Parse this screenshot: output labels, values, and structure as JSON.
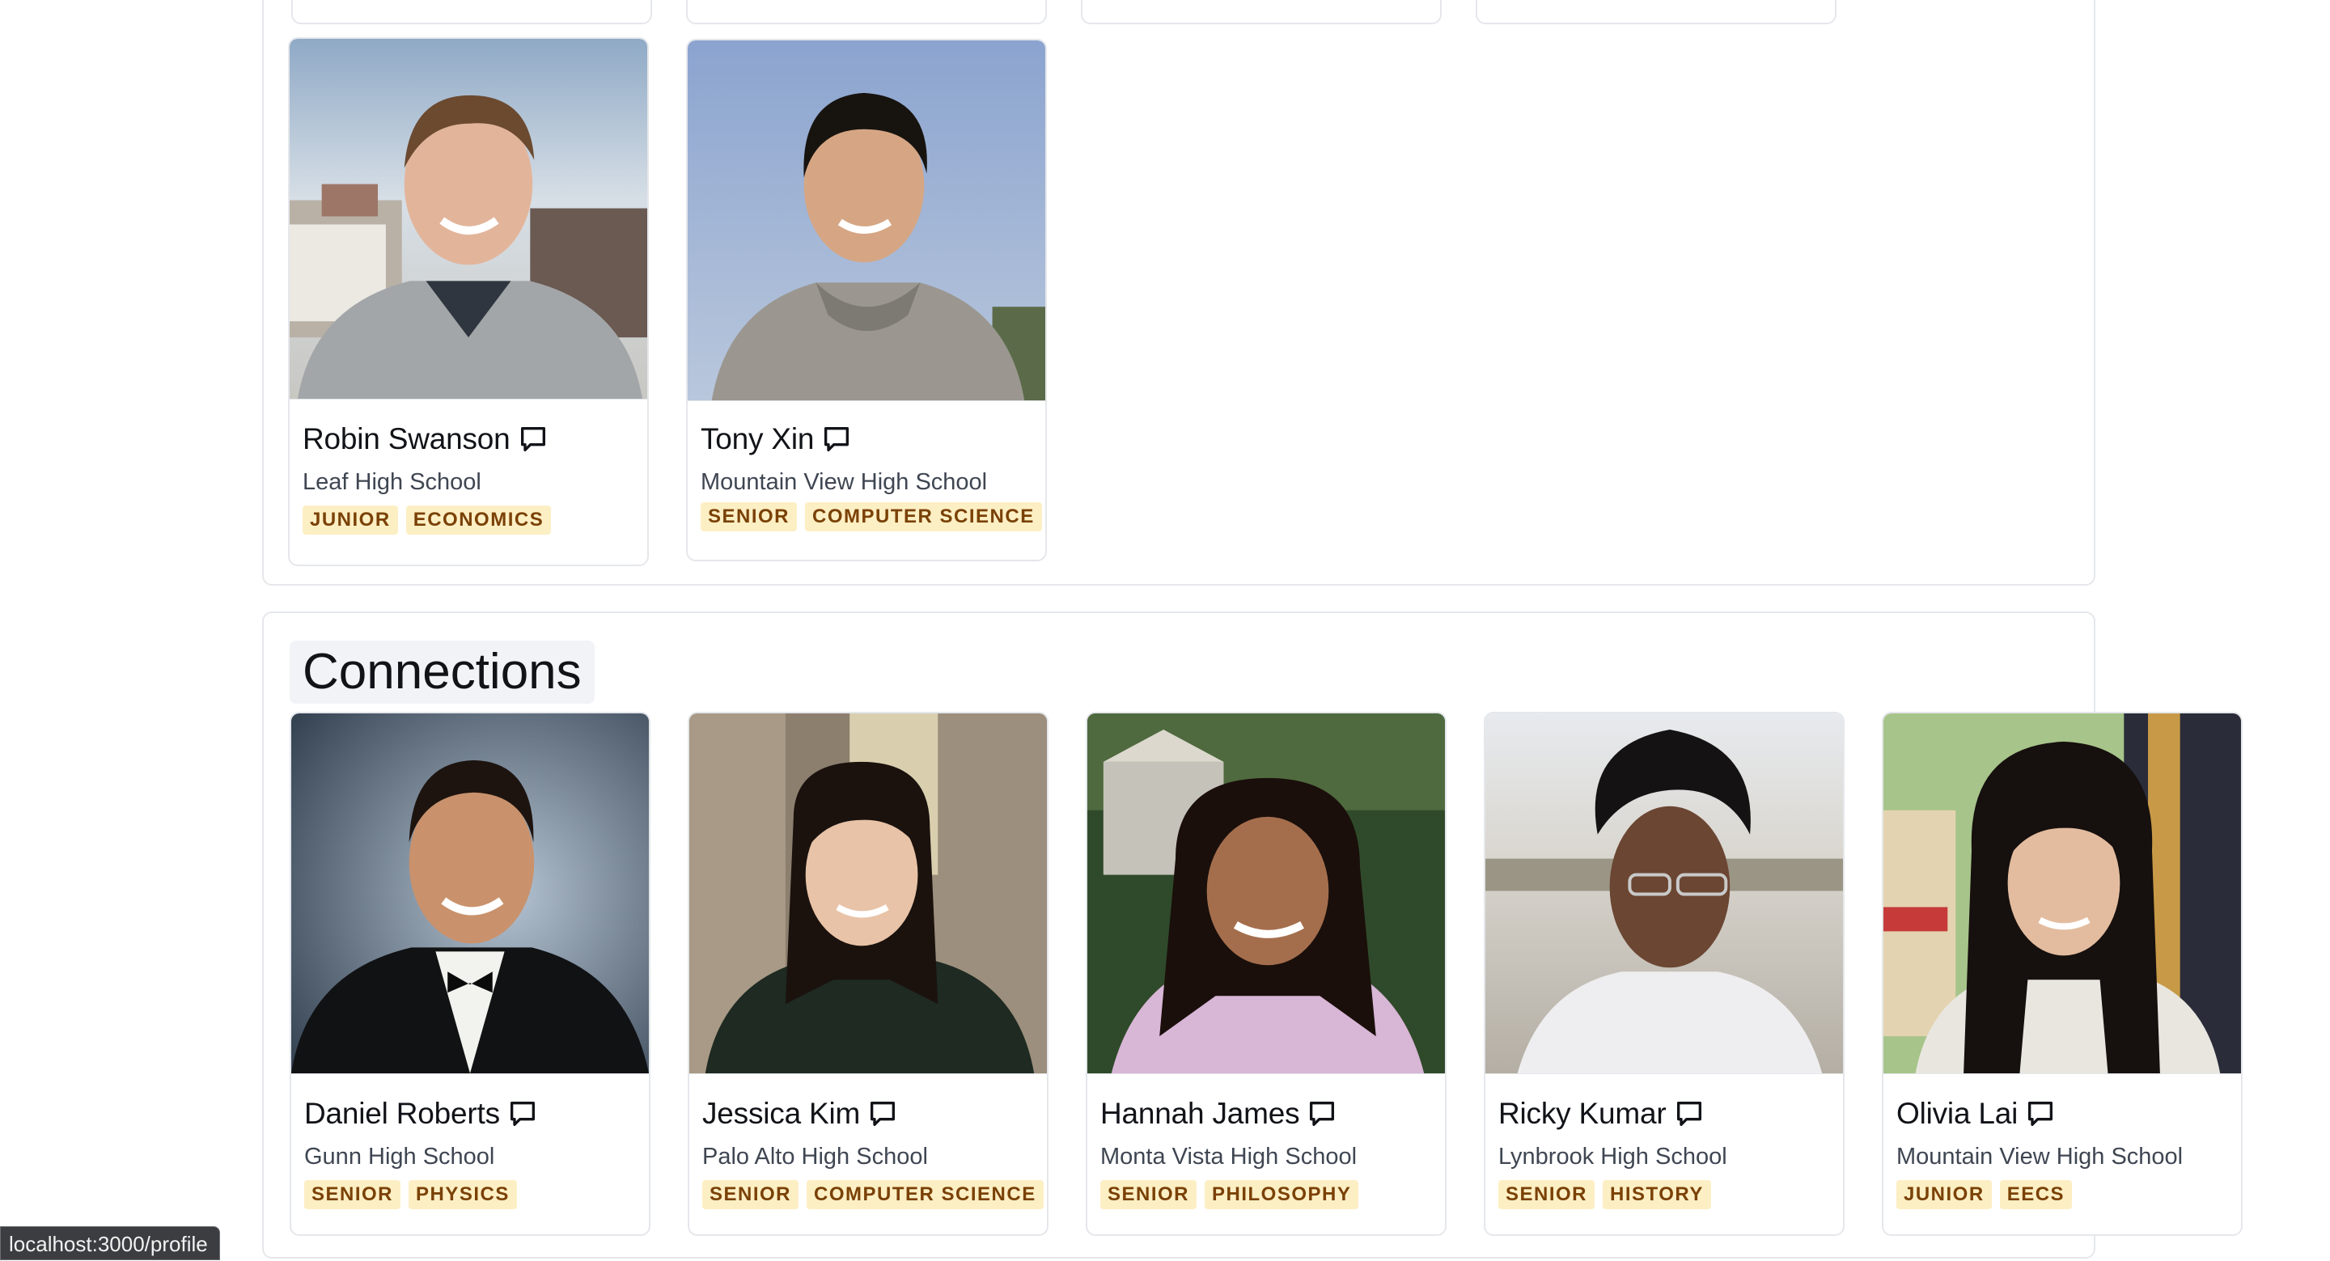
{
  "students": [
    {
      "name": "Robin Swanson",
      "school": "Leaf High School",
      "tags": [
        "JUNIOR",
        "ECONOMICS"
      ]
    },
    {
      "name": "Tony Xin",
      "school": "Mountain View High School",
      "tags": [
        "SENIOR",
        "COMPUTER SCIENCE"
      ]
    }
  ],
  "connections": {
    "title": "Connections",
    "people": [
      {
        "name": "Daniel Roberts",
        "school": "Gunn High School",
        "tags": [
          "SENIOR",
          "PHYSICS"
        ]
      },
      {
        "name": "Jessica Kim",
        "school": "Palo Alto High School",
        "tags": [
          "SENIOR",
          "COMPUTER SCIENCE"
        ]
      },
      {
        "name": "Hannah James",
        "school": "Monta Vista High School",
        "tags": [
          "SENIOR",
          "PHILOSOPHY"
        ]
      },
      {
        "name": "Ricky Kumar",
        "school": "Lynbrook High School",
        "tags": [
          "SENIOR",
          "HISTORY"
        ]
      },
      {
        "name": "Olivia Lai",
        "school": "Mountain View High School",
        "tags": [
          "JUNIOR",
          "EECS"
        ]
      }
    ]
  },
  "status_bar": {
    "url": "localhost:3000/profile"
  },
  "colors": {
    "tag_bg": "#fdefc4",
    "tag_text": "#7a4106",
    "border": "#e5e7eb"
  },
  "icons": {
    "message": "chat-bubble-icon"
  }
}
